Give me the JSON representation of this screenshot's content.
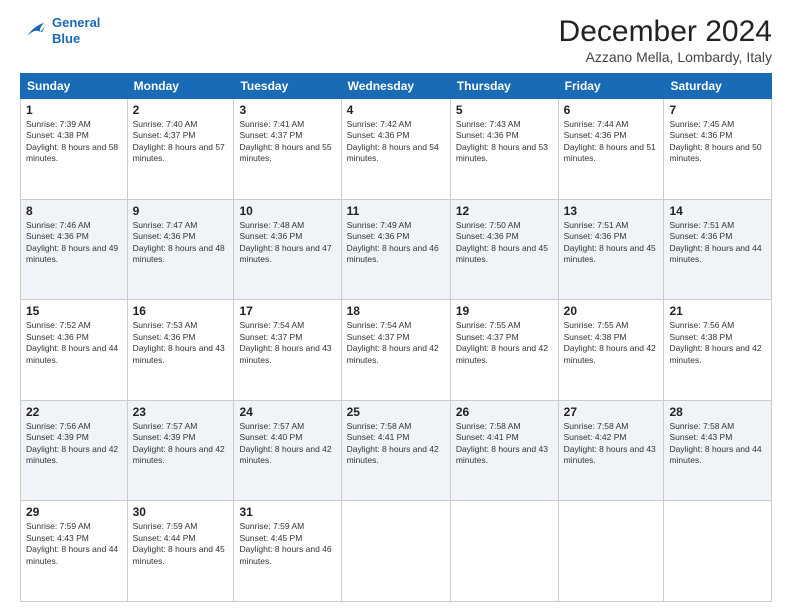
{
  "logo": {
    "line1": "General",
    "line2": "Blue"
  },
  "title": "December 2024",
  "location": "Azzano Mella, Lombardy, Italy",
  "days_of_week": [
    "Sunday",
    "Monday",
    "Tuesday",
    "Wednesday",
    "Thursday",
    "Friday",
    "Saturday"
  ],
  "weeks": [
    [
      {
        "day": "1",
        "sunrise": "7:39 AM",
        "sunset": "4:38 PM",
        "daylight": "8 hours and 58 minutes."
      },
      {
        "day": "2",
        "sunrise": "7:40 AM",
        "sunset": "4:37 PM",
        "daylight": "8 hours and 57 minutes."
      },
      {
        "day": "3",
        "sunrise": "7:41 AM",
        "sunset": "4:37 PM",
        "daylight": "8 hours and 55 minutes."
      },
      {
        "day": "4",
        "sunrise": "7:42 AM",
        "sunset": "4:36 PM",
        "daylight": "8 hours and 54 minutes."
      },
      {
        "day": "5",
        "sunrise": "7:43 AM",
        "sunset": "4:36 PM",
        "daylight": "8 hours and 53 minutes."
      },
      {
        "day": "6",
        "sunrise": "7:44 AM",
        "sunset": "4:36 PM",
        "daylight": "8 hours and 51 minutes."
      },
      {
        "day": "7",
        "sunrise": "7:45 AM",
        "sunset": "4:36 PM",
        "daylight": "8 hours and 50 minutes."
      }
    ],
    [
      {
        "day": "8",
        "sunrise": "7:46 AM",
        "sunset": "4:36 PM",
        "daylight": "8 hours and 49 minutes."
      },
      {
        "day": "9",
        "sunrise": "7:47 AM",
        "sunset": "4:36 PM",
        "daylight": "8 hours and 48 minutes."
      },
      {
        "day": "10",
        "sunrise": "7:48 AM",
        "sunset": "4:36 PM",
        "daylight": "8 hours and 47 minutes."
      },
      {
        "day": "11",
        "sunrise": "7:49 AM",
        "sunset": "4:36 PM",
        "daylight": "8 hours and 46 minutes."
      },
      {
        "day": "12",
        "sunrise": "7:50 AM",
        "sunset": "4:36 PM",
        "daylight": "8 hours and 45 minutes."
      },
      {
        "day": "13",
        "sunrise": "7:51 AM",
        "sunset": "4:36 PM",
        "daylight": "8 hours and 45 minutes."
      },
      {
        "day": "14",
        "sunrise": "7:51 AM",
        "sunset": "4:36 PM",
        "daylight": "8 hours and 44 minutes."
      }
    ],
    [
      {
        "day": "15",
        "sunrise": "7:52 AM",
        "sunset": "4:36 PM",
        "daylight": "8 hours and 44 minutes."
      },
      {
        "day": "16",
        "sunrise": "7:53 AM",
        "sunset": "4:36 PM",
        "daylight": "8 hours and 43 minutes."
      },
      {
        "day": "17",
        "sunrise": "7:54 AM",
        "sunset": "4:37 PM",
        "daylight": "8 hours and 43 minutes."
      },
      {
        "day": "18",
        "sunrise": "7:54 AM",
        "sunset": "4:37 PM",
        "daylight": "8 hours and 42 minutes."
      },
      {
        "day": "19",
        "sunrise": "7:55 AM",
        "sunset": "4:37 PM",
        "daylight": "8 hours and 42 minutes."
      },
      {
        "day": "20",
        "sunrise": "7:55 AM",
        "sunset": "4:38 PM",
        "daylight": "8 hours and 42 minutes."
      },
      {
        "day": "21",
        "sunrise": "7:56 AM",
        "sunset": "4:38 PM",
        "daylight": "8 hours and 42 minutes."
      }
    ],
    [
      {
        "day": "22",
        "sunrise": "7:56 AM",
        "sunset": "4:39 PM",
        "daylight": "8 hours and 42 minutes."
      },
      {
        "day": "23",
        "sunrise": "7:57 AM",
        "sunset": "4:39 PM",
        "daylight": "8 hours and 42 minutes."
      },
      {
        "day": "24",
        "sunrise": "7:57 AM",
        "sunset": "4:40 PM",
        "daylight": "8 hours and 42 minutes."
      },
      {
        "day": "25",
        "sunrise": "7:58 AM",
        "sunset": "4:41 PM",
        "daylight": "8 hours and 42 minutes."
      },
      {
        "day": "26",
        "sunrise": "7:58 AM",
        "sunset": "4:41 PM",
        "daylight": "8 hours and 43 minutes."
      },
      {
        "day": "27",
        "sunrise": "7:58 AM",
        "sunset": "4:42 PM",
        "daylight": "8 hours and 43 minutes."
      },
      {
        "day": "28",
        "sunrise": "7:58 AM",
        "sunset": "4:43 PM",
        "daylight": "8 hours and 44 minutes."
      }
    ],
    [
      {
        "day": "29",
        "sunrise": "7:59 AM",
        "sunset": "4:43 PM",
        "daylight": "8 hours and 44 minutes."
      },
      {
        "day": "30",
        "sunrise": "7:59 AM",
        "sunset": "4:44 PM",
        "daylight": "8 hours and 45 minutes."
      },
      {
        "day": "31",
        "sunrise": "7:59 AM",
        "sunset": "4:45 PM",
        "daylight": "8 hours and 46 minutes."
      },
      null,
      null,
      null,
      null
    ]
  ]
}
